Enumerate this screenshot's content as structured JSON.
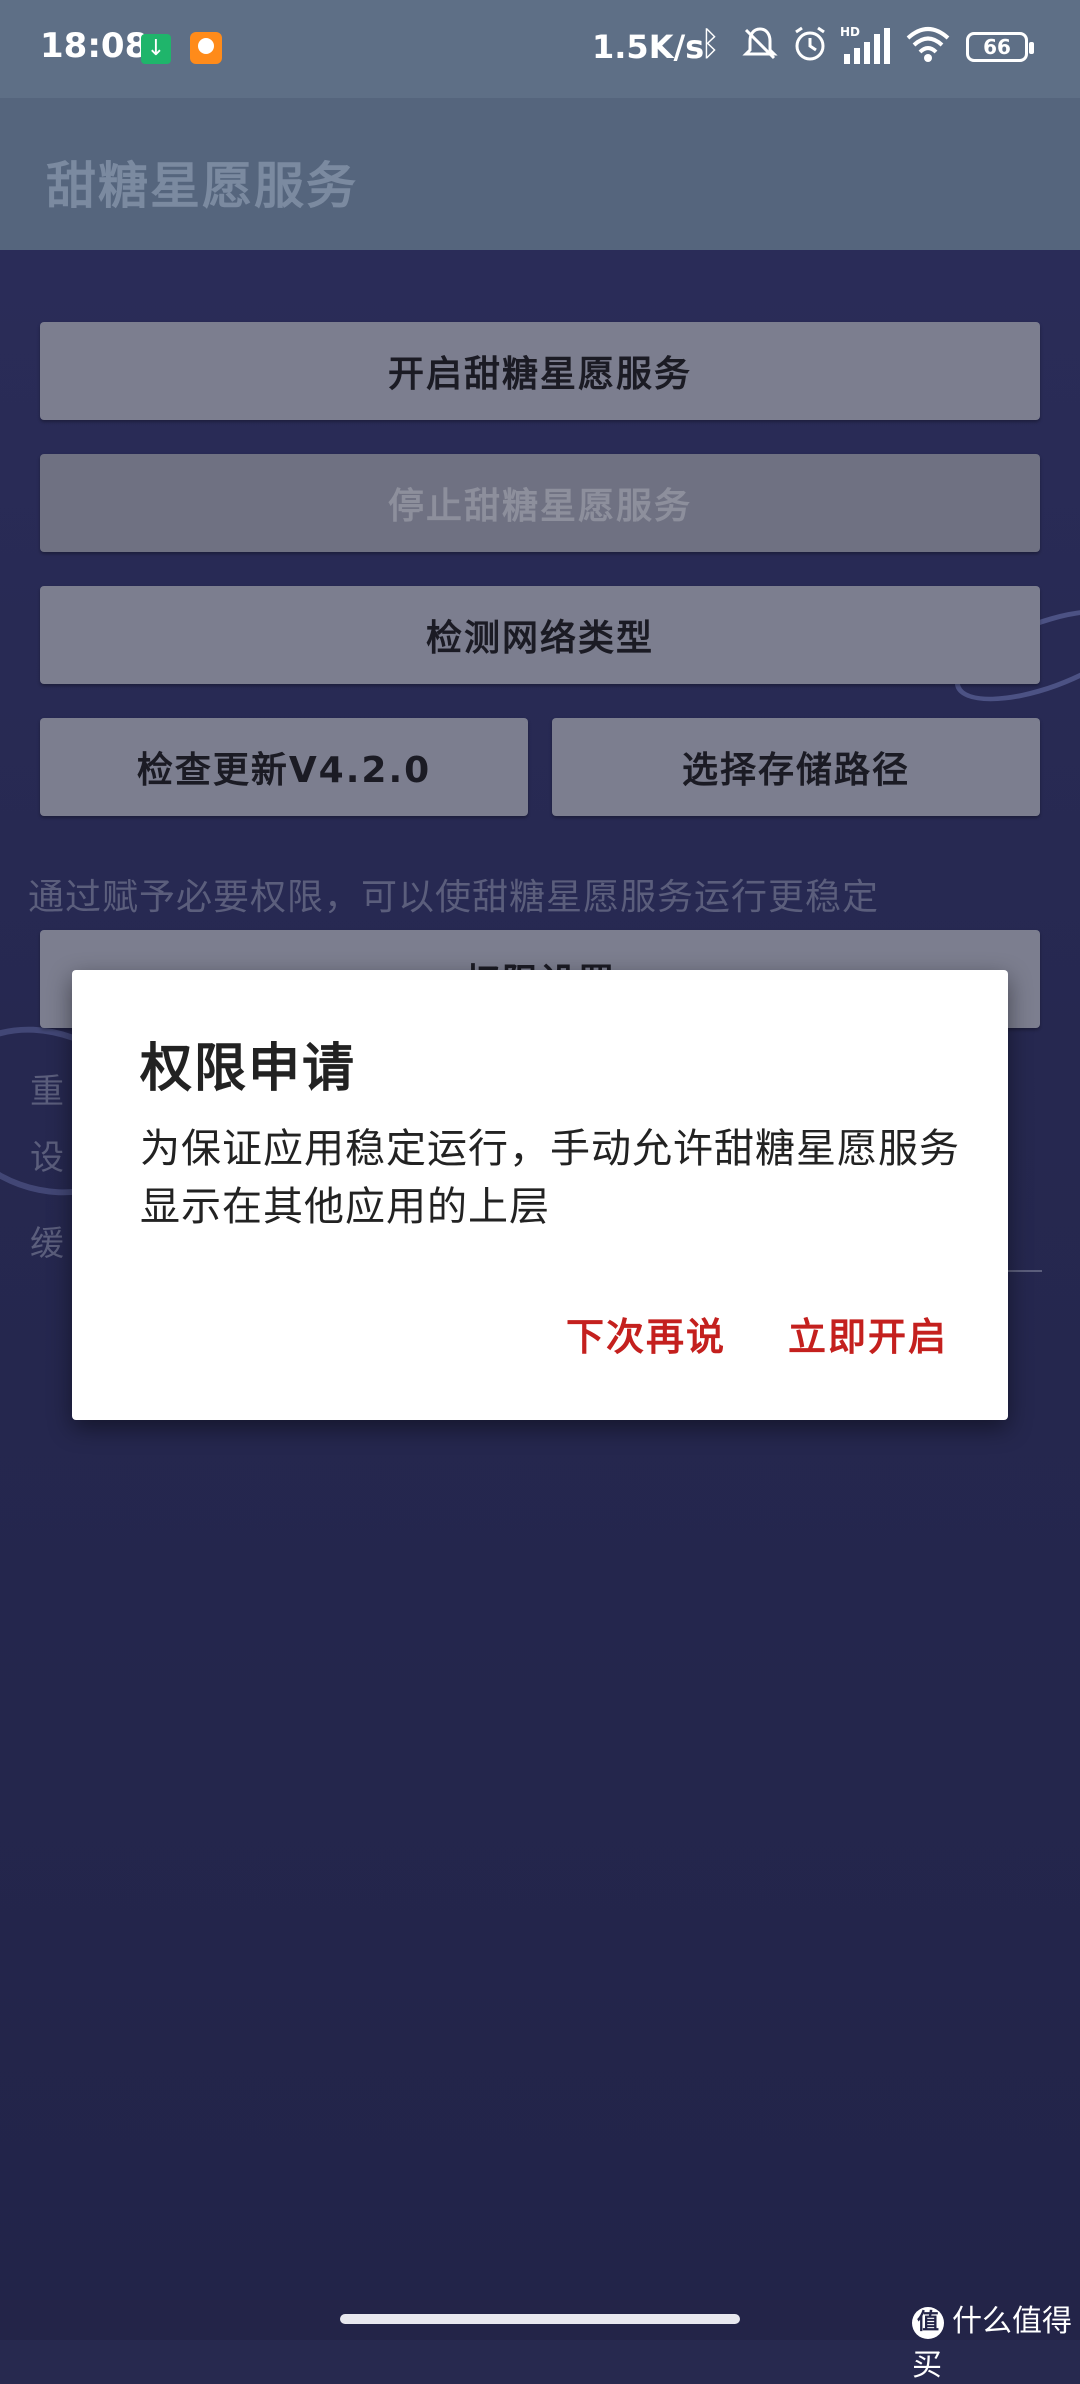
{
  "status_bar": {
    "time": "18:08",
    "net_speed": "1.5K/s",
    "battery": "66",
    "icons": [
      "download-notification-icon",
      "app-notification-icon",
      "bluetooth-icon",
      "mute-icon",
      "alarm-icon",
      "signal-hd-icon",
      "wifi-icon",
      "battery-icon"
    ],
    "hd_label": "HD"
  },
  "app_bar": {
    "title": "甜糖星愿服务"
  },
  "buttons": {
    "start": "开启甜糖星愿服务",
    "stop": "停止甜糖星愿服务",
    "detect_network": "检测网络类型",
    "check_update": "检查更新V4.2.0",
    "select_path": "选择存储路径",
    "permission_settings": "权限设置"
  },
  "hint": "通过赋予必要权限，可以使甜糖星愿服务运行更稳定",
  "side_labels": [
    "重",
    "设",
    "缓"
  ],
  "dialog": {
    "title": "权限申请",
    "message": "为保证应用稳定运行，手动允许甜糖星愿服务显示在其他应用的上层",
    "negative": "下次再说",
    "positive": "立即开启"
  },
  "watermark": {
    "badge": "值",
    "text": "什么值得买"
  }
}
